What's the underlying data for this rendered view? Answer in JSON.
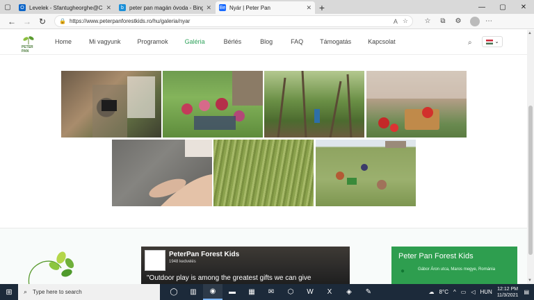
{
  "browser": {
    "tabs": [
      {
        "title": "Levelek - Sfantugheorghe@CH",
        "favicon": "outlook-icon",
        "color": "#0a64c8",
        "glyph": "O"
      },
      {
        "title": "peter pan magán óvoda - Bing",
        "favicon": "bing-icon",
        "color": "#1a8fd8",
        "glyph": "b"
      },
      {
        "title": "Nyár | Peter Pan",
        "favicon": "behance-icon",
        "color": "#1769ff",
        "glyph": "Be"
      }
    ],
    "url": "https://www.peterpanforestkids.ro/hu/galeria/nyar"
  },
  "site": {
    "logo_text": "PETER PAN",
    "nav": [
      "Home",
      "Mi vagyunk",
      "Programok",
      "Galéria",
      "Bérlés",
      "Blog",
      "FAQ",
      "Támogatás",
      "Kapcsolat"
    ],
    "active_nav": "Galéria",
    "language": "HU"
  },
  "footer": {
    "fb_page_name": "PeterPan Forest Kids",
    "fb_likes": "1948 kedvelés",
    "fb_quote": "\"Outdoor play is among the greatest gifts we can give",
    "contact_title": "Peter Pan Forest Kids",
    "address": "Gábor Áron utca, Maros megye, Románia"
  },
  "taskbar": {
    "search_placeholder": "Type here to search",
    "weather": "8°C",
    "language": "HUN",
    "time": "12:12 PM",
    "date": "11/3/2021"
  }
}
